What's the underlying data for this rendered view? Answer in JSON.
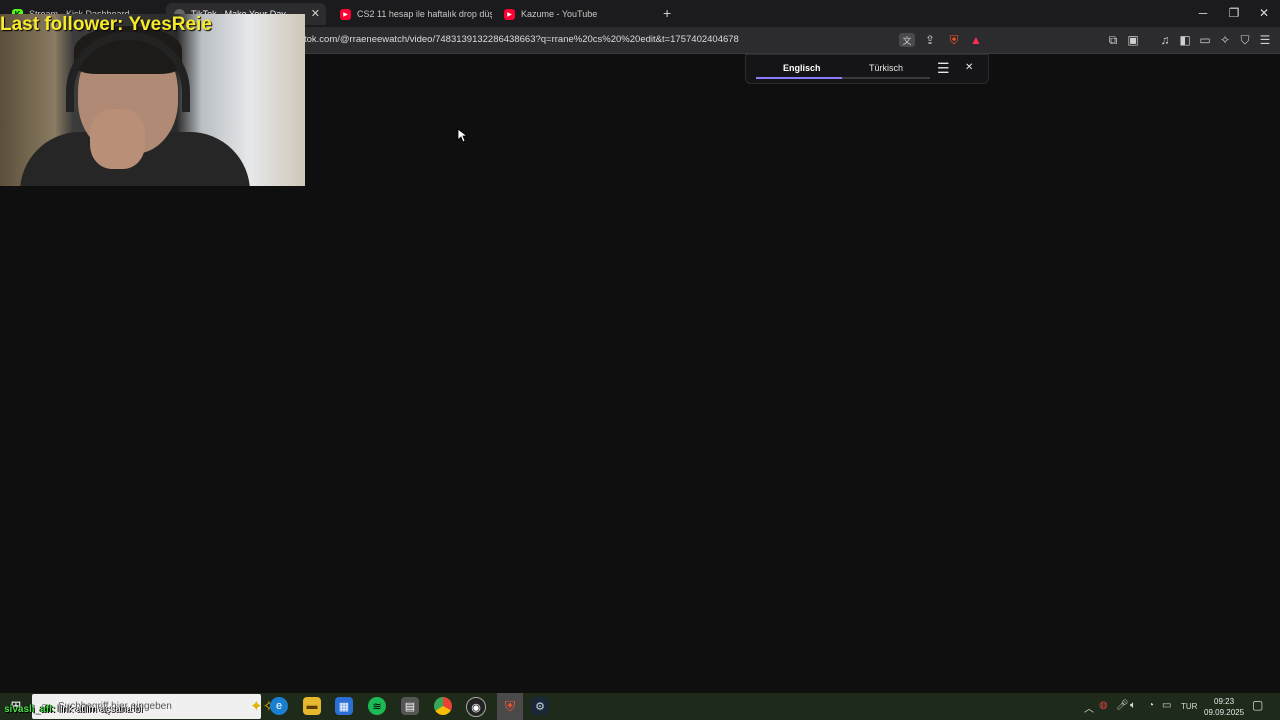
{
  "tabs": [
    {
      "title": "Stream - Kick Dashboard",
      "favicon": "kick-icon",
      "color": "#53fc18"
    },
    {
      "title": "TikTok - Make Your Day",
      "favicon": "globe-icon",
      "color": "#777777"
    },
    {
      "title": "CS2 11 hesap ile haftalık drop düşür",
      "favicon": "youtube-icon",
      "color": "#ff0033"
    },
    {
      "title": "Kazume - YouTube",
      "favicon": "youtube-icon",
      "color": "#ff0033"
    }
  ],
  "toolbar": {
    "url": "tok.com/@rraeneewatch/video/7483139132286438663?q=rrane%20cs%20%20edit&t=1757402404678"
  },
  "translate_bar": {
    "source_lang": "Englisch",
    "target_lang": "Türkisch",
    "accent": "#8a7cff"
  },
  "webcam": {
    "follower_text": "Last follower: YvesReie"
  },
  "taskbar": {
    "search_placeholder": "Suchbegriff hier eingeben",
    "lang": "TUR",
    "time": "09:23",
    "date": "09.09.2025"
  },
  "chat_overlay": {
    "user": "sivasli_afi",
    "message": "link atiim açsana bi"
  }
}
